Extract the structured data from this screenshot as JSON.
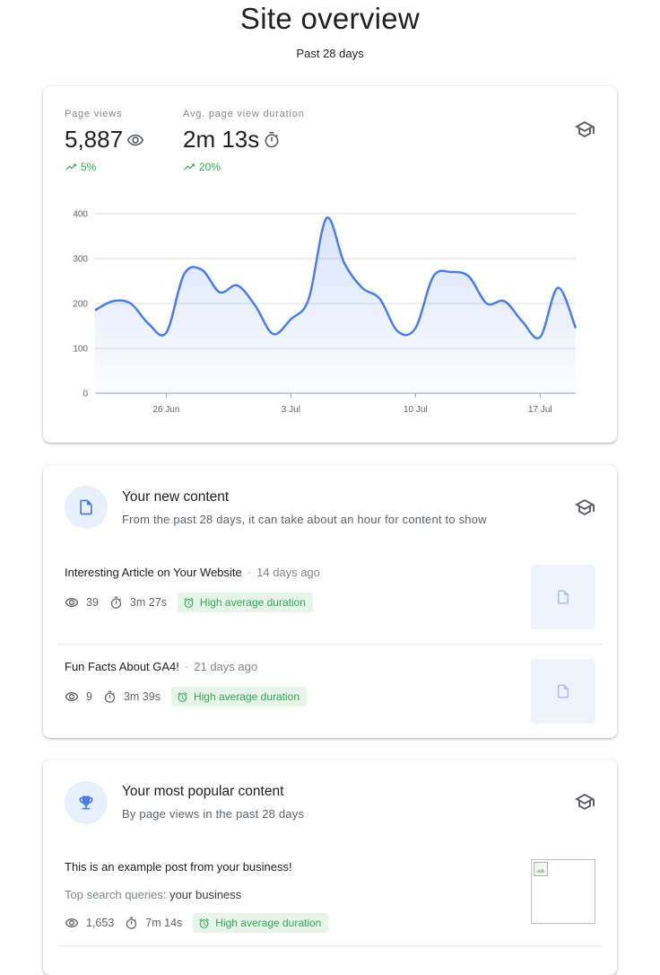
{
  "header": {
    "title": "Site overview",
    "subtitle": "Past 28 days"
  },
  "overview": {
    "page_views": {
      "label": "Page views",
      "value": "5,887",
      "trend": "5%",
      "icon": "eye-icon"
    },
    "avg_duration": {
      "label": "Avg. page view duration",
      "value": "2m 13s",
      "trend": "20%",
      "icon": "timer-icon"
    },
    "learn_icon": "graduation-cap-icon"
  },
  "chart_data": {
    "type": "area",
    "x_ticks": [
      "26 Jun",
      "3 Jul",
      "10 Jul",
      "17 Jul"
    ],
    "y_ticks": [
      0,
      100,
      200,
      300,
      400
    ],
    "ylim": [
      0,
      400
    ],
    "x": [
      "22 Jun",
      "23 Jun",
      "24 Jun",
      "25 Jun",
      "26 Jun",
      "27 Jun",
      "28 Jun",
      "29 Jun",
      "30 Jun",
      "1 Jul",
      "2 Jul",
      "3 Jul",
      "4 Jul",
      "5 Jul",
      "6 Jul",
      "7 Jul",
      "8 Jul",
      "9 Jul",
      "10 Jul",
      "11 Jul",
      "12 Jul",
      "13 Jul",
      "14 Jul",
      "15 Jul",
      "16 Jul",
      "17 Jul",
      "18 Jul",
      "19 Jul"
    ],
    "values": [
      185,
      205,
      200,
      155,
      135,
      265,
      275,
      225,
      240,
      195,
      132,
      165,
      210,
      390,
      290,
      235,
      210,
      138,
      145,
      260,
      270,
      260,
      200,
      205,
      160,
      125,
      235,
      145
    ],
    "color": "#4c7de6",
    "grid": true
  },
  "new_content": {
    "title": "Your new content",
    "subtitle": "From the past 28 days, it can take about an hour for content to show",
    "items": [
      {
        "title": "Interesting Article on Your Website",
        "age": "14 days ago",
        "views": "39",
        "duration": "3m 27s",
        "badge": "High average duration"
      },
      {
        "title": "Fun Facts About GA4!",
        "age": "21 days ago",
        "views": "9",
        "duration": "3m 39s",
        "badge": "High average duration"
      }
    ]
  },
  "popular_content": {
    "title": "Your most popular content",
    "subtitle": "By page views in the past 28 days",
    "items": [
      {
        "title": "This is an example post from your business!",
        "queries_label": "Top search queries:",
        "queries_value": "your business",
        "views": "1,653",
        "duration": "7m 14s",
        "badge": "High average duration"
      }
    ]
  },
  "colors": {
    "accent": "#4c7de6",
    "positive": "#34a853",
    "badge_bg": "#e6f4ea",
    "icon_bg": "#e8f0fe"
  }
}
